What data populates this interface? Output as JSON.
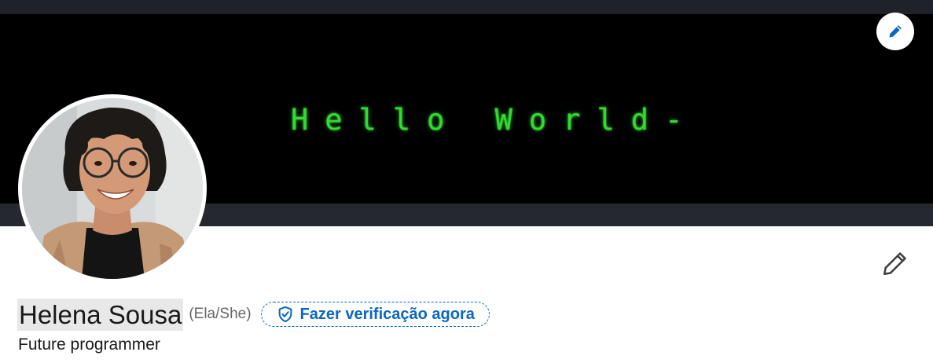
{
  "cover": {
    "text": "Hello World-",
    "edit_icon": "pencil-icon"
  },
  "profile": {
    "name": "Helena Sousa",
    "pronouns": "(Ela/She)",
    "verify_label": "Fazer verificação agora",
    "verify_icon": "shield-check-icon",
    "headline": "Future programmer",
    "edit_icon": "pencil-icon"
  },
  "colors": {
    "accent": "#0a66c2",
    "terminal_green": "#2fdc2f",
    "text": "#191919",
    "muted": "#666666"
  }
}
